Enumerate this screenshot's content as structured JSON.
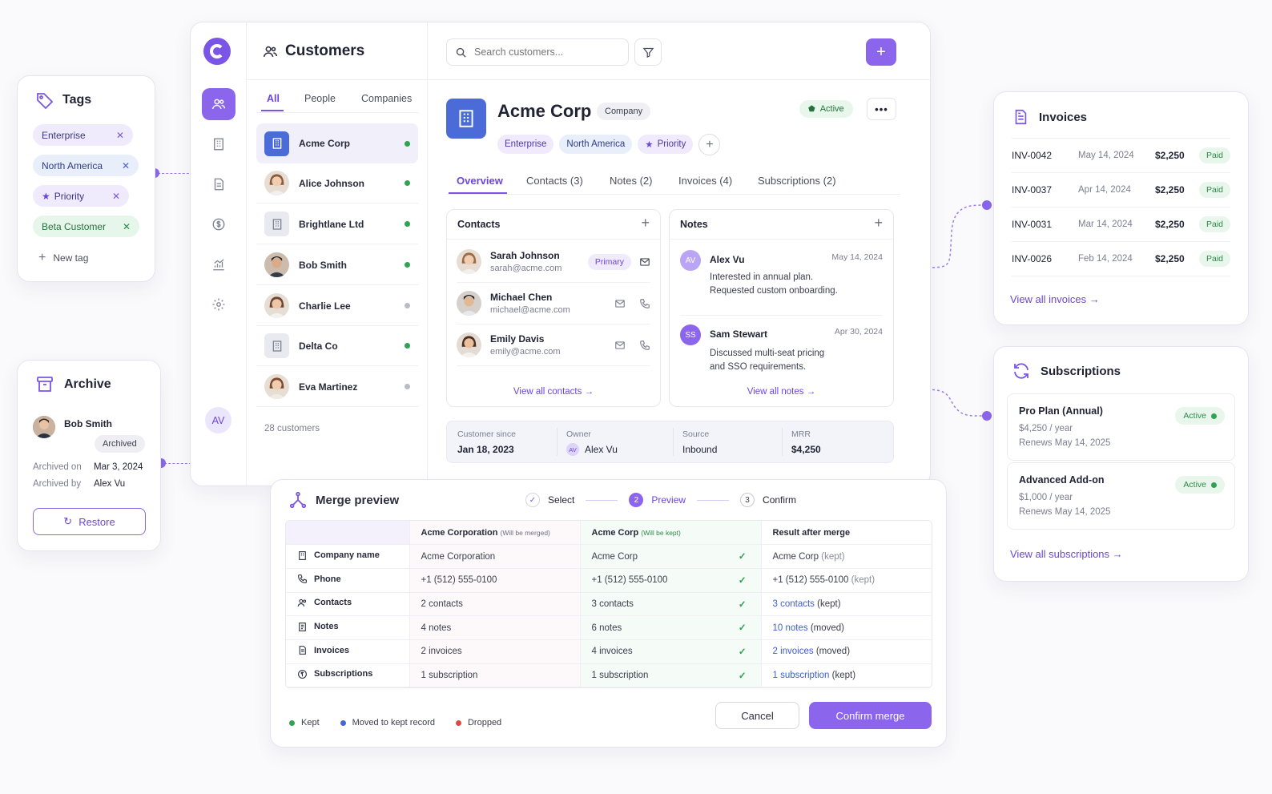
{
  "colors": {
    "accent": "#8b66ec",
    "active": "#2fa352",
    "inactive": "#b9bcc7",
    "moved": "#4568d6",
    "dropped": "#e04646"
  },
  "app": {
    "title": "Customers",
    "user_initials": "AV"
  },
  "search": {
    "placeholder": "Search customers..."
  },
  "list": {
    "tabs": [
      "All",
      "People",
      "Companies"
    ],
    "active_tab": "All",
    "items": [
      {
        "name": "Acme Corp",
        "type": "company",
        "active": true,
        "selected": true
      },
      {
        "name": "Alice Johnson",
        "type": "person",
        "active": true
      },
      {
        "name": "Brightlane Ltd",
        "type": "company",
        "active": true
      },
      {
        "name": "Bob Smith",
        "type": "person",
        "active": true
      },
      {
        "name": "Charlie Lee",
        "type": "person",
        "active": false
      },
      {
        "name": "Delta Co",
        "type": "company",
        "active": true
      },
      {
        "name": "Eva Martinez",
        "type": "person",
        "active": false
      }
    ],
    "count": "28 customers"
  },
  "detail": {
    "name": "Acme Corp",
    "type_badge": "Company",
    "status": "Active",
    "tags": [
      "Enterprise",
      "North America",
      "Priority"
    ],
    "tabs": [
      "Overview",
      "Contacts (3)",
      "Notes (2)",
      "Invoices (4)",
      "Subscriptions (2)"
    ],
    "contacts_title": "Contacts",
    "contacts": [
      {
        "name": "Sarah Johnson",
        "email": "sarah@acme.com",
        "badge": "Primary"
      },
      {
        "name": "Michael Chen",
        "email": "michael@acme.com"
      },
      {
        "name": "Emily Davis",
        "email": "emily@acme.com"
      }
    ],
    "view_contacts": "View all contacts",
    "notes_title": "Notes",
    "notes": [
      {
        "author": "Alex Vu",
        "initials": "AV",
        "date": "May 14, 2024",
        "text1": "Interested in annual plan.",
        "text2": "Requested custom onboarding."
      },
      {
        "author": "Sam Stewart",
        "initials": "SS",
        "date": "Apr 30, 2024",
        "text1": "Discussed multi-seat pricing",
        "text2": "and SSO requirements."
      }
    ],
    "view_notes": "View all notes",
    "meta": [
      {
        "label": "Customer since",
        "value": "Jan 18, 2023"
      },
      {
        "label": "Owner",
        "value": "Alex Vu",
        "initials": "AV"
      },
      {
        "label": "Source",
        "value": "Inbound"
      },
      {
        "label": "MRR",
        "value": "$4,250"
      }
    ]
  },
  "tags_card": {
    "title": "Tags",
    "tags": [
      "Enterprise",
      "North America",
      "Priority",
      "Beta Customer"
    ],
    "new_tag": "New tag"
  },
  "archive_card": {
    "title": "Archive",
    "name": "Bob Smith",
    "badge": "Archived",
    "archived_on_label": "Archived on",
    "archived_on": "Mar 3, 2024",
    "archived_by_label": "Archived by",
    "archived_by": "Alex Vu",
    "restore": "Restore"
  },
  "invoices_card": {
    "title": "Invoices",
    "rows": [
      {
        "id": "INV-0042",
        "date": "May 14, 2024",
        "amount": "$2,250",
        "status": "Paid"
      },
      {
        "id": "INV-0037",
        "date": "Apr 14, 2024",
        "amount": "$2,250",
        "status": "Paid"
      },
      {
        "id": "INV-0031",
        "date": "Mar 14, 2024",
        "amount": "$2,250",
        "status": "Paid"
      },
      {
        "id": "INV-0026",
        "date": "Feb 14, 2024",
        "amount": "$2,250",
        "status": "Paid"
      }
    ],
    "view_all": "View all invoices"
  },
  "subs_card": {
    "title": "Subscriptions",
    "items": [
      {
        "name": "Pro Plan (Annual)",
        "price": "$4,250 / year",
        "renews": "Renews May 14, 2025",
        "status": "Active"
      },
      {
        "name": "Advanced Add-on",
        "price": "$1,000 / year",
        "renews": "Renews May 14, 2025",
        "status": "Active"
      }
    ],
    "view_all": "View all subscriptions"
  },
  "merge": {
    "title": "Merge preview",
    "steps": [
      {
        "num": "✓",
        "label": "Select"
      },
      {
        "num": "2",
        "label": "Preview"
      },
      {
        "num": "3",
        "label": "Confirm"
      }
    ],
    "col_a": "Acme Corporation",
    "col_a_note": "(Will be merged)",
    "col_b": "Acme Corp",
    "col_b_note": "(Will be kept)",
    "col_c": "Result after merge",
    "rows": [
      {
        "label": "Company name",
        "a": "Acme Corporation",
        "b": "Acme Corp",
        "r": "Acme Corp",
        "rnote": "(kept)",
        "rstyle": "kept"
      },
      {
        "label": "Phone",
        "a": "+1 (512) 555-0100",
        "b": "+1 (512) 555-0100",
        "r": "+1 (512) 555-0100",
        "rnote": "(kept)",
        "rstyle": "kept"
      },
      {
        "label": "Contacts",
        "a": "2 contacts",
        "b": "3 contacts",
        "r": "3 contacts",
        "rnote": "(kept)",
        "rstyle": "link"
      },
      {
        "label": "Notes",
        "a": "4 notes",
        "b": "6 notes",
        "r": "10 notes",
        "rnote": "(moved)",
        "rstyle": "link"
      },
      {
        "label": "Invoices",
        "a": "2 invoices",
        "b": "4 invoices",
        "r": "2 invoices",
        "rnote": "(moved)",
        "rstyle": "link"
      },
      {
        "label": "Subscriptions",
        "a": "1 subscription",
        "b": "1 subscription",
        "r": "1 subscription",
        "rnote": "(kept)",
        "rstyle": "link"
      }
    ],
    "legend": [
      "Kept",
      "Moved to kept record",
      "Dropped"
    ],
    "cancel": "Cancel",
    "confirm": "Confirm merge"
  }
}
